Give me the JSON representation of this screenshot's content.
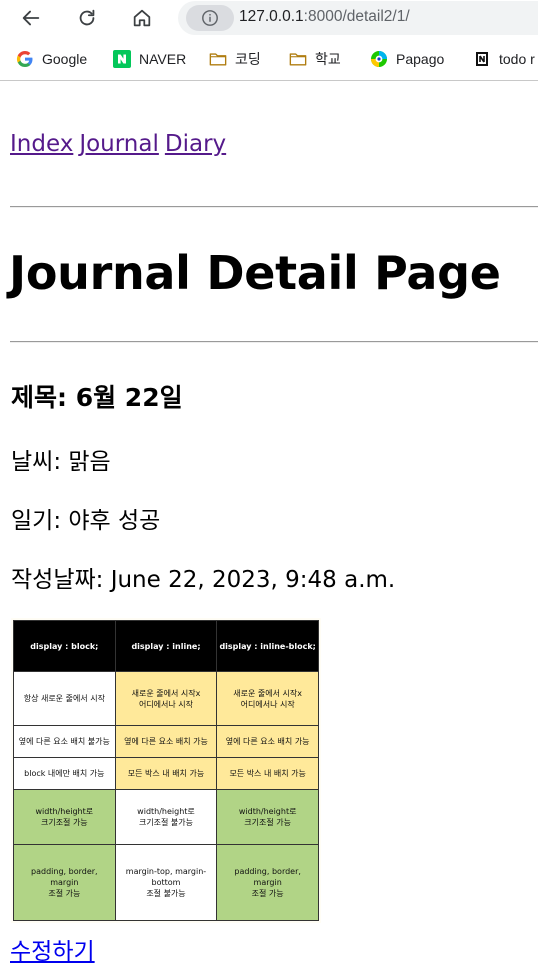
{
  "browser": {
    "url_host": "127.0.0.1",
    "url_rest": ":8000/detail2/1/",
    "bookmarks": [
      {
        "label": "Google",
        "icon": "google-icon"
      },
      {
        "label": "NAVER",
        "icon": "naver-icon"
      },
      {
        "label": "코딩",
        "icon": "folder-icon"
      },
      {
        "label": "학교",
        "icon": "folder-icon"
      },
      {
        "label": "Papago",
        "icon": "papago-icon"
      },
      {
        "label": "todo r",
        "icon": "notion-icon"
      }
    ]
  },
  "nav": {
    "links": [
      "Index",
      "Journal",
      "Diary"
    ]
  },
  "page": {
    "title": "Journal Detail Page",
    "subject": "제목: 6월 22일",
    "weather": "날씨: 맑음",
    "diary": "일기: 야후 성공",
    "created": "작성날짜: June 22, 2023, 9:48 a.m.",
    "edit_link": "수정하기"
  },
  "image_table": {
    "header": [
      "display : block;",
      "display : inline;",
      "display : inline-block;"
    ],
    "rows": [
      [
        "항상 새로운 줄에서 시작",
        "새로운 줄에서 시작x\n어디에서나 시작",
        "새로운 줄에서 시작x\n어디에서나 시작"
      ],
      [
        "옆에 다른 요소 배치 불가능",
        "옆에 다른 요소 배치 가능",
        "옆에 다른 요소 배치 가능"
      ],
      [
        "block 내에만 배치 가능",
        "모든 박스 내 배치 가능",
        "모든 박스 내 배치 가능"
      ],
      [
        "width/height로\n크기조절 가능",
        "width/height로\n크기조절 불가능",
        "width/height로\n크기조절 가능"
      ],
      [
        "padding, border, margin\n조절 가능",
        "margin-top, margin-bottom\n조절 불가능",
        "padding, border, margin\n조절 가능"
      ]
    ],
    "cell_colors": [
      [
        "#ffffff",
        "#ffe99a",
        "#ffe99a"
      ],
      [
        "#ffffff",
        "#ffe99a",
        "#ffe99a"
      ],
      [
        "#ffffff",
        "#ffe99a",
        "#ffe99a"
      ],
      [
        "#b1d486",
        "#ffffff",
        "#b1d486"
      ],
      [
        "#b1d486",
        "#ffffff",
        "#b1d486"
      ]
    ]
  },
  "colors": {
    "visited_link": "#551a8b",
    "link": "#0000ee"
  }
}
